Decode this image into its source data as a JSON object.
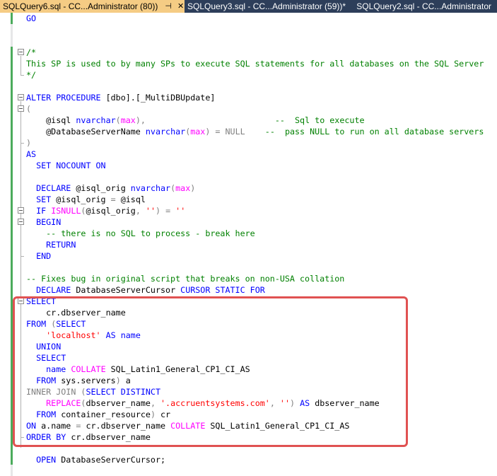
{
  "tabs": [
    {
      "label": "SQLQuery6.sql - CC...Administrator (80))",
      "active": true
    },
    {
      "label": "SQLQuery3.sql - CC...Administrator (59))*",
      "active": false
    },
    {
      "label": "SQLQuery2.sql - CC...Administrator",
      "active": false
    }
  ],
  "icons": {
    "pin": "pin-icon",
    "close": "close-icon"
  },
  "colors": {
    "keyword": "#0000ff",
    "string": "#ff0000",
    "comment": "#008000",
    "function": "#ff00ff",
    "operator": "#808080",
    "highlight": "#e05252"
  },
  "code": {
    "l1": "GO",
    "l4a": "/*",
    "l5": "This SP is used to by many SPs to execute SQL statements for all databases on the SQL Server",
    "l6": "*/",
    "l8_k": "ALTER PROCEDURE",
    "l8_t": " [dbo].[_MultiDBUpdate]",
    "l9": "(",
    "l10_v": "    @isql ",
    "l10_k": "nvarchar",
    "l10_p1": "(",
    "l10_m": "max",
    "l10_p2": "),",
    "l10_c": "                          --  Sql to execute",
    "l11_v": "    @DatabaseServerName ",
    "l11_k": "nvarchar",
    "l11_p1": "(",
    "l11_m": "max",
    "l11_p2": ") = NULL",
    "l11_c": "    --  pass NULL to run on all database servers",
    "l12": ")",
    "l13": "AS",
    "l14": "  SET NOCOUNT ON",
    "l16_k": "  DECLARE",
    "l16_t": " @isql_orig ",
    "l16_k2": "nvarchar",
    "l16_p1": "(",
    "l16_m": "max",
    "l16_p2": ")",
    "l17_k": "  SET",
    "l17_t": " @isql_orig ",
    "l17_g": "=",
    "l17_t2": " @isql",
    "l18_k": "  IF ",
    "l18_m": "ISNULL",
    "l18_g1": "(",
    "l18_t": "@isql_orig",
    "l18_g2": ", ",
    "l18_s": "''",
    "l18_g3": ") = ",
    "l18_s2": "''",
    "l19": "  BEGIN",
    "l20": "    -- there is no SQL to process - break here",
    "l21": "    RETURN",
    "l22": "  END",
    "l24": "-- Fixes bug in original script that breaks on non-USA collation",
    "l25_k": "  DECLARE",
    "l25_t": " DatabaseServerCursor ",
    "l25_k2": "CURSOR STATIC FOR",
    "l26": "SELECT",
    "l27": "    cr.dbserver_name",
    "l28_k": "FROM",
    "l28_g": " (",
    "l28_k2": "SELECT",
    "l29_s": "    'localhost'",
    "l29_k": " AS",
    "l29_t": " name",
    "l30": "  UNION",
    "l31": "  SELECT",
    "l32_t": "    name ",
    "l32_m": "COLLATE",
    "l32_t2": " SQL_Latin1_General_CP1_CI_AS",
    "l33_k": "  FROM",
    "l33_t": " sys.servers",
    "l33_g": ")",
    "l33_t2": " a",
    "l34_g": "INNER JOIN",
    "l34_g2": " (",
    "l34_k": "SELECT DISTINCT",
    "l35_m": "    REPLACE",
    "l35_g1": "(",
    "l35_t": "dbserver_name",
    "l35_g2": ", ",
    "l35_s": "'.accruentsystems.com'",
    "l35_g3": ", ",
    "l35_s2": "''",
    "l35_g4": ")",
    "l35_k": " AS",
    "l35_t2": " dbserver_name",
    "l36_k": "  FROM",
    "l36_t": " container_resource",
    "l36_g": ")",
    "l36_t2": " cr",
    "l37_k": "ON",
    "l37_t": " a.name ",
    "l37_g": "=",
    "l37_t2": " cr.dbserver_name ",
    "l37_m": "COLLATE",
    "l37_t3": " SQL_Latin1_General_CP1_CI_AS",
    "l38_k": "ORDER BY",
    "l38_t": " cr.dbserver_name",
    "l40_k": "  OPEN",
    "l40_t": " DatabaseServerCursor;"
  }
}
